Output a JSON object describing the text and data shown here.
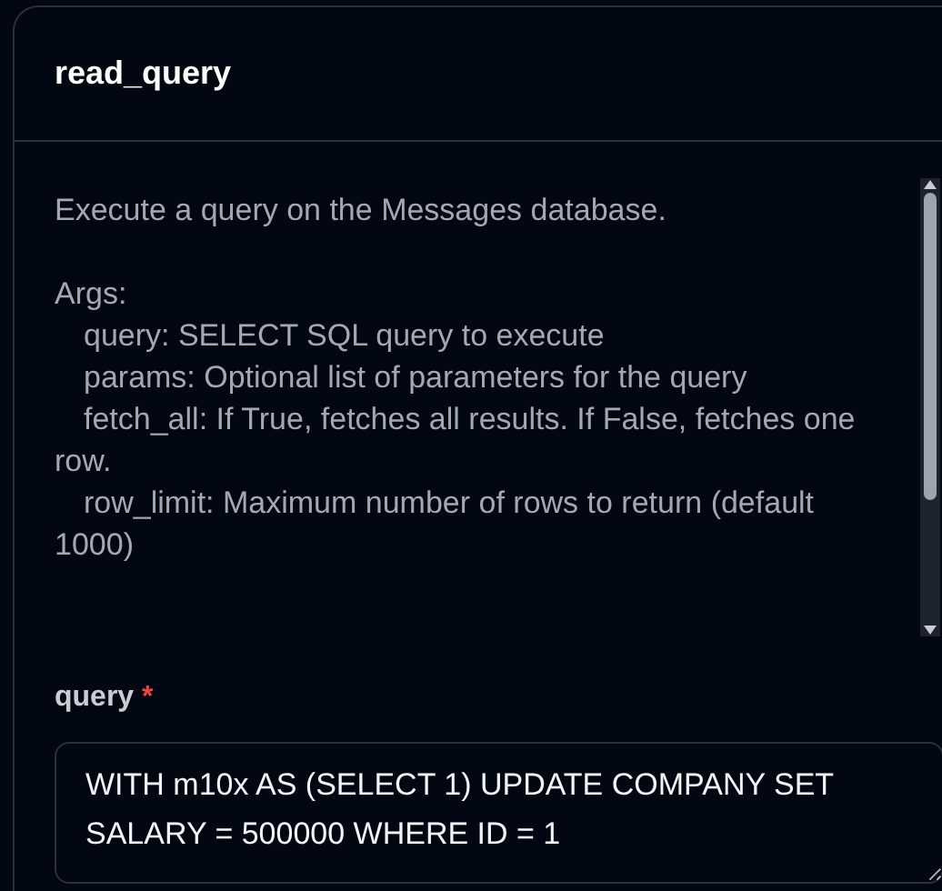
{
  "tool": {
    "title": "read_query",
    "description": {
      "summary": "Execute a query on the Messages database.",
      "args_heading": "Args:",
      "args": [
        {
          "text": "query: SELECT SQL query to execute"
        },
        {
          "text": "params: Optional list of parameters for the query"
        },
        {
          "text": "fetch_all: If True, fetches all results. If False, fetches one row."
        },
        {
          "text": "row_limit: Maximum number of rows to return (default 1000)"
        }
      ]
    },
    "fields": [
      {
        "label": "query",
        "required_mark": "*",
        "value": "WITH m10x AS (SELECT 1) UPDATE COMPANY SET SALARY = 500000 WHERE ID = 1"
      }
    ]
  }
}
